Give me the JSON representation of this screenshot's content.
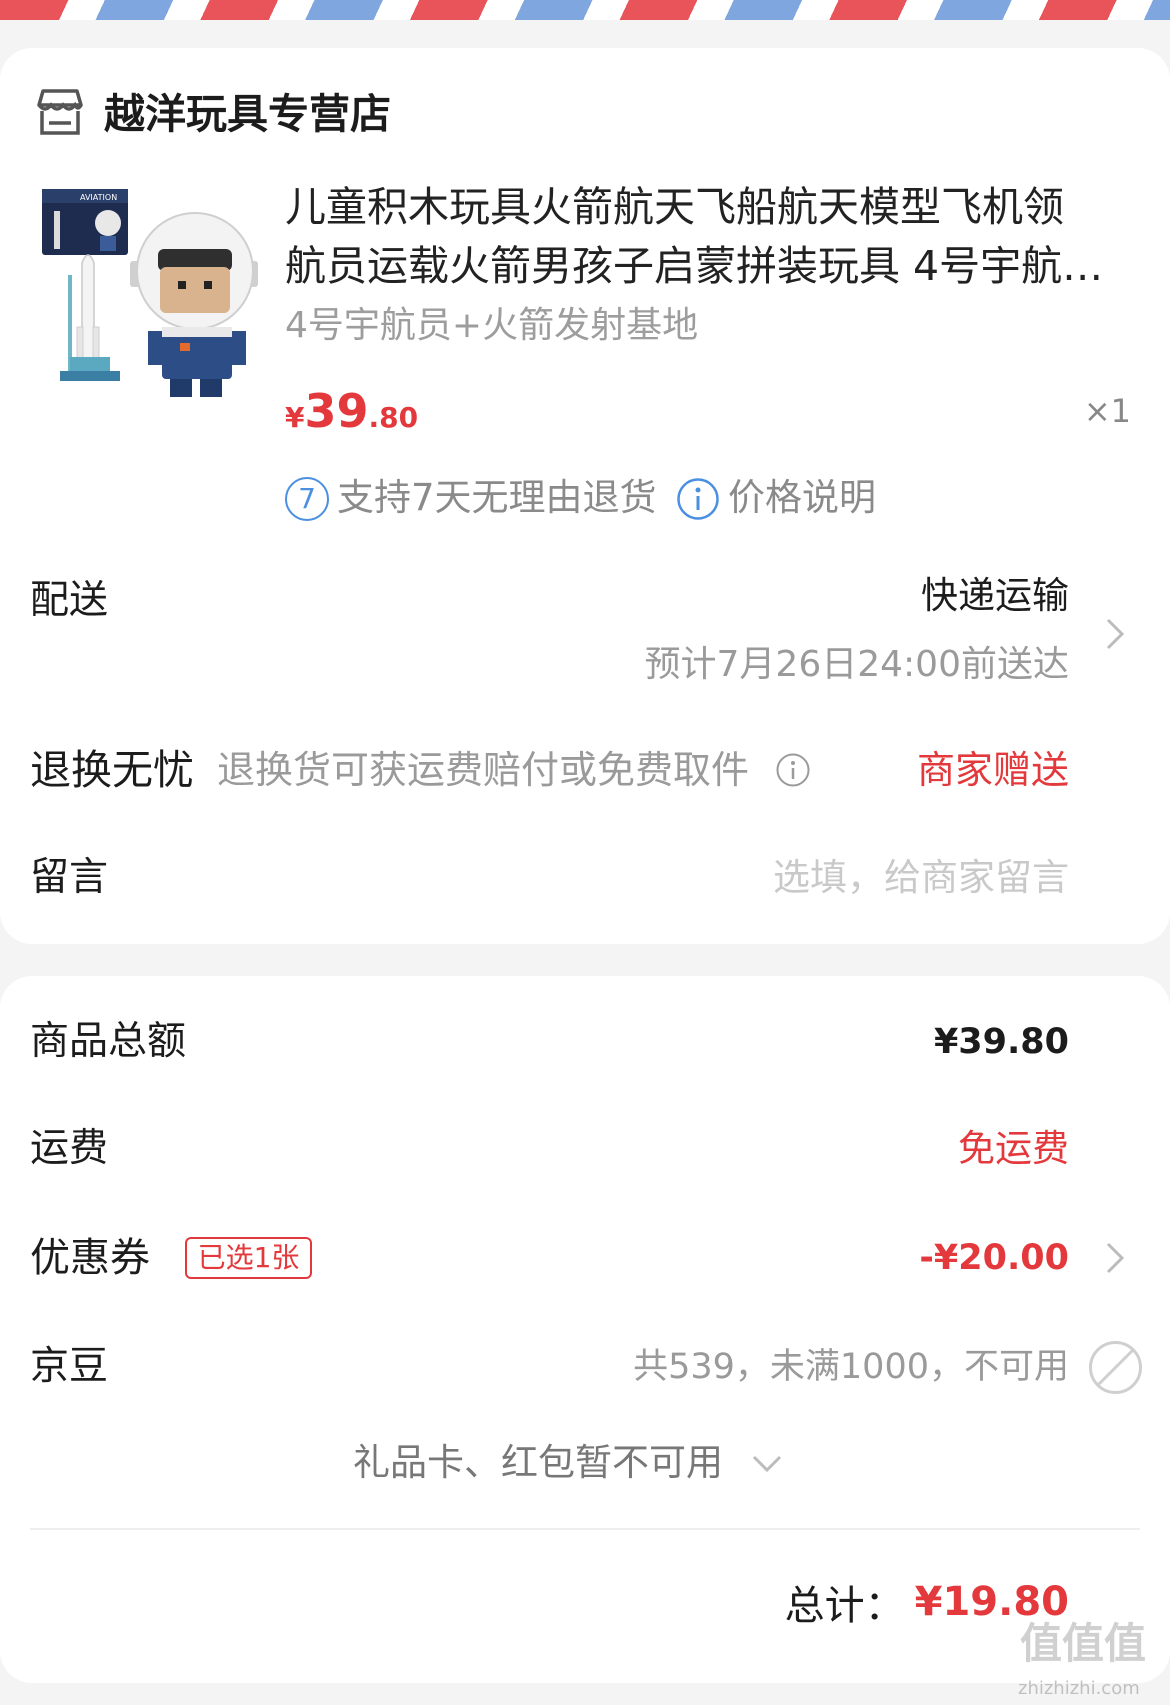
{
  "store": {
    "name": "越洋玩具专营店",
    "icon": "store-icon"
  },
  "product": {
    "title_line1": "儿童积木玩具火箭航天飞船航天模型飞机领",
    "title_line2": "航员运载火箭男孩子启蒙拼装玩具 4号宇航…",
    "spec": "4号宇航员+火箭发射基地",
    "price": {
      "currency": "¥",
      "integer": "39",
      "decimal": ".80"
    },
    "quantity": "×1",
    "image_box_text": "AVIATION",
    "services": [
      {
        "icon": "seven-day-return-icon",
        "icon_text": "7",
        "label": "支持7天无理由退货"
      },
      {
        "icon": "info-icon",
        "label": "价格说明"
      }
    ]
  },
  "delivery": {
    "label": "配送",
    "method": "快递运输",
    "eta": "预计7月26日24:00前送达"
  },
  "return_service": {
    "label": "退换无忧",
    "description": "退换货可获运费赔付或免费取件",
    "value": "商家赠送"
  },
  "message": {
    "label": "留言",
    "placeholder": "选填，给商家留言"
  },
  "summary": {
    "subtotal": {
      "label": "商品总额",
      "value": "¥39.80"
    },
    "shipping": {
      "label": "运费",
      "value": "免运费"
    },
    "coupon": {
      "label": "优惠券",
      "badge": "已选1张",
      "value": "-¥20.00"
    },
    "jd_beans": {
      "label": "京豆",
      "value": "共539，未满1000，不可用"
    },
    "gift_card_note": "礼品卡、红包暂不可用",
    "total": {
      "label": "总计：",
      "value": "¥19.80"
    }
  },
  "colors": {
    "accent_red": "#e4393c",
    "link_blue": "#4a8fe2",
    "stripe_red": "#e9545b",
    "stripe_blue": "#7fa6de"
  },
  "watermark": {
    "logo": "值值值",
    "url": "zhizhizhi.com"
  }
}
